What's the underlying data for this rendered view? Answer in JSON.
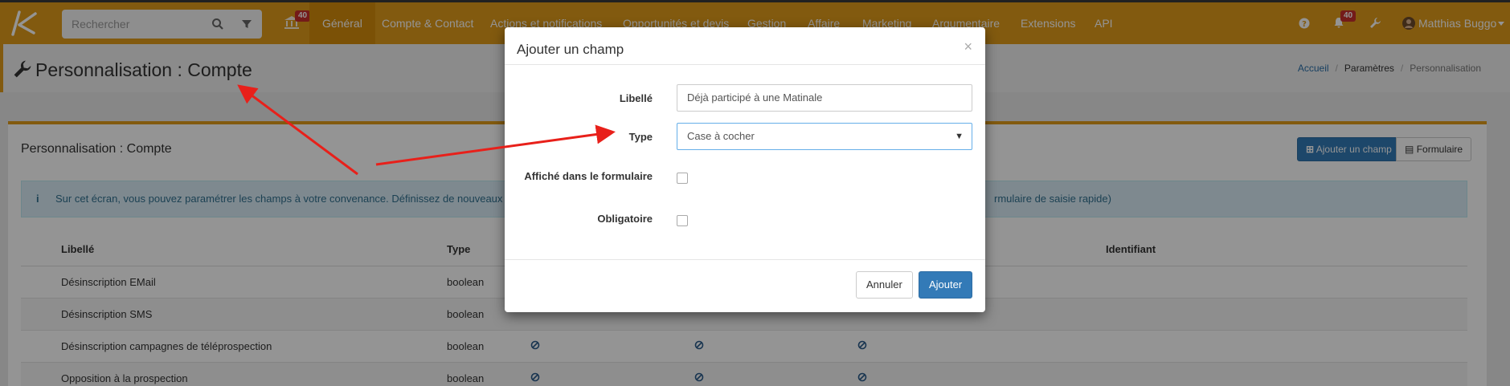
{
  "navbar": {
    "search_placeholder": "Rechercher",
    "bank_badge": "40",
    "items": [
      "Général",
      "Compte & Contact",
      "Actions et notifications",
      "Opportunités et devis",
      "Gestion",
      "Affaire",
      "Marketing",
      "Argumentaire",
      "Extensions",
      "API"
    ],
    "notif_badge": "40",
    "user_name": "Matthias Buggo",
    "accent_color": "#e09b1a"
  },
  "header": {
    "title": "Personnalisation : Compte",
    "breadcrumb": [
      "Accueil",
      "Paramètres",
      "Personnalisation"
    ]
  },
  "panel": {
    "title": "Personnalisation : Compte",
    "add_button": "Ajouter un champ",
    "form_button": "Formulaire",
    "info_text_left": "Sur cet écran, vous pouvez paramétrer les champs à votre convenance. Définissez de nouveaux c",
    "info_text_right": "rmulaire de saisie rapide)",
    "columns": [
      "Libellé",
      "Type",
      "Identifiant"
    ],
    "rows": [
      {
        "label": "Désinscription EMail",
        "type": "boolean"
      },
      {
        "label": "Désinscription SMS",
        "type": "boolean"
      },
      {
        "label": "Désinscription campagnes de téléprospection",
        "type": "boolean"
      },
      {
        "label": "Opposition à la prospection",
        "type": "boolean"
      }
    ]
  },
  "modal": {
    "title": "Ajouter un champ",
    "close": "×",
    "label_libelle": "Libellé",
    "value_libelle": "Déjà participé à une Matinale",
    "label_type": "Type",
    "value_type": "Case à cocher",
    "label_affiche": "Affiché dans le formulaire",
    "label_obligatoire": "Obligatoire",
    "cancel": "Annuler",
    "submit": "Ajouter"
  }
}
